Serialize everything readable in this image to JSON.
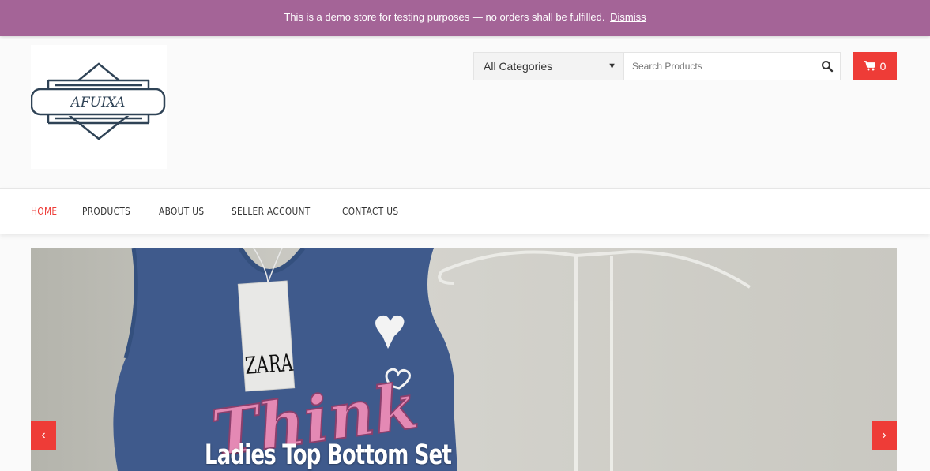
{
  "demo_notice": {
    "text": "This is a demo store for testing purposes — no orders shall be fulfilled.",
    "dismiss_label": "Dismiss",
    "background_color": "#a46497"
  },
  "logo": {
    "text": "AFUIXA"
  },
  "search": {
    "category_selected": "All Categories",
    "placeholder": "Search Products"
  },
  "cart": {
    "count": "0"
  },
  "nav": {
    "items": [
      {
        "label": "HOME",
        "active": true
      },
      {
        "label": "PRODUCTS",
        "active": false
      },
      {
        "label": "ABOUT US",
        "active": false
      },
      {
        "label": "SELLER ACCOUNT",
        "active": false
      },
      {
        "label": "CONTACT US",
        "active": false
      }
    ]
  },
  "hero": {
    "caption": "Ladies Top Bottom Set",
    "tag_text": "ZARA",
    "shirt_text": "Think",
    "prev_icon": "chevron-left-icon",
    "next_icon": "chevron-right-icon"
  },
  "colors": {
    "accent": "#ee3c37",
    "shirt": "#3f5a8c"
  }
}
